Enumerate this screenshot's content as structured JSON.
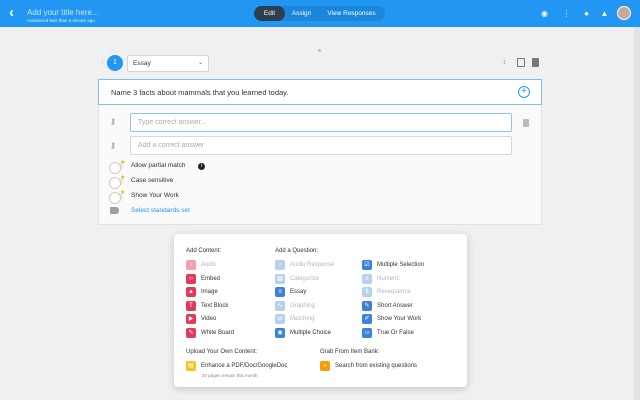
{
  "header": {
    "title_placeholder": "Add your title here...",
    "autosave_text": "Autosaved less than a minute ago",
    "tabs": [
      {
        "label": "Edit",
        "active": true
      },
      {
        "label": "Assign",
        "active": false
      },
      {
        "label": "View Responses",
        "active": false
      }
    ],
    "accent": "#2196f3"
  },
  "question": {
    "number": "1",
    "type": "Essay",
    "points_label": "1",
    "prompt": "Name 3 facts about mammals that you learned today."
  },
  "answers": {
    "placeholder_1": "Type correct answer...",
    "placeholder_2": "Add a correct answer"
  },
  "options": [
    {
      "label": "Allow partial match"
    },
    {
      "label": "Case sensitive"
    },
    {
      "label": "Show Your Work"
    }
  ],
  "standards_link": "Select standards set",
  "add_menu": {
    "content_heading": "Add Content:",
    "question_heading": "Add a Question:",
    "content_items": [
      {
        "label": "Audio",
        "color": "#f2a0b0",
        "enabled": false
      },
      {
        "label": "Embed",
        "color": "#e23a5a",
        "enabled": true
      },
      {
        "label": "Image",
        "color": "#e23a5a",
        "enabled": true
      },
      {
        "label": "Text Block",
        "color": "#e23a5a",
        "enabled": true
      },
      {
        "label": "Video",
        "color": "#e23a5a",
        "enabled": true
      },
      {
        "label": "White Board",
        "color": "#e23a5a",
        "enabled": true
      }
    ],
    "question_col1": [
      {
        "label": "Audio Response",
        "color": "#b6d0ee",
        "enabled": false
      },
      {
        "label": "Categorize",
        "color": "#b6d0ee",
        "enabled": false
      },
      {
        "label": "Essay",
        "color": "#3c82d8",
        "enabled": true
      },
      {
        "label": "Graphing",
        "color": "#b6d0ee",
        "enabled": false
      },
      {
        "label": "Matching",
        "color": "#b6d0ee",
        "enabled": false
      },
      {
        "label": "Multiple Choice",
        "color": "#3c82d8",
        "enabled": true
      }
    ],
    "question_col2": [
      {
        "label": "Multiple Selection",
        "color": "#3c82d8",
        "enabled": true
      },
      {
        "label": "Numeric",
        "color": "#b6d0ee",
        "enabled": false
      },
      {
        "label": "Resequence",
        "color": "#b6d0ee",
        "enabled": false
      },
      {
        "label": "Short Answer",
        "color": "#3c82d8",
        "enabled": true
      },
      {
        "label": "Show Your Work",
        "color": "#3c82d8",
        "enabled": true
      },
      {
        "label": "True Or False",
        "color": "#3c82d8",
        "enabled": true
      }
    ],
    "upload_heading": "Upload Your Own Content:",
    "upload_item": "Enhance a PDF/Doc/GoogleDoc",
    "upload_sub": "20 pages remain this month",
    "bank_heading": "Grab From Item Bank:",
    "bank_item": "Search from existing questions"
  }
}
